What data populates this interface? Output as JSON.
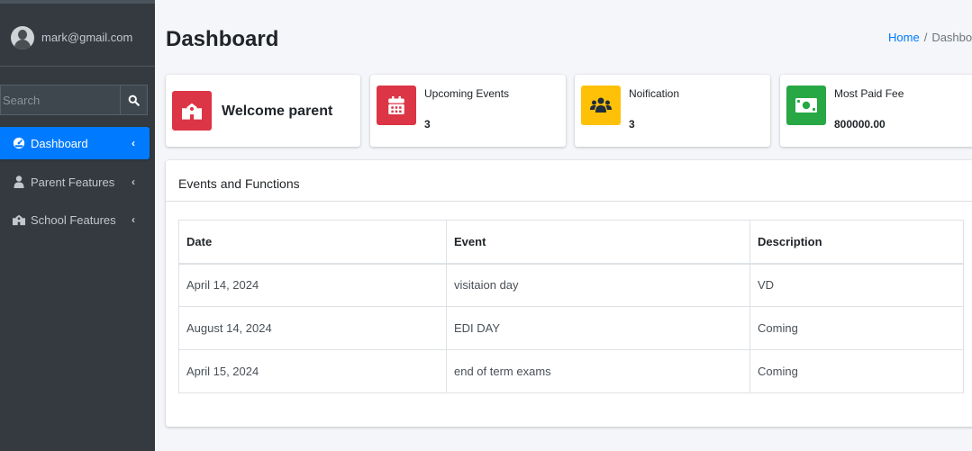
{
  "user": {
    "email": "mark@gmail.com"
  },
  "search": {
    "placeholder": "Search"
  },
  "sidebar": {
    "items": [
      {
        "label": "Dashboard",
        "icon": "tachometer-icon",
        "active": true
      },
      {
        "label": "Parent Features",
        "icon": "user-icon",
        "active": false
      },
      {
        "label": "School Features",
        "icon": "school-icon",
        "active": false
      }
    ]
  },
  "header": {
    "title": "Dashboard",
    "breadcrumb": {
      "home": "Home",
      "separator": "/",
      "current": "Dashboard"
    }
  },
  "info_boxes": [
    {
      "label": "Welcome parent",
      "icon": "school-icon",
      "color": "#dc3545"
    },
    {
      "label": "Upcoming Events",
      "value": "3",
      "icon": "calendar-icon",
      "color": "#dc3545"
    },
    {
      "label": "Noification",
      "value": "3",
      "icon": "users-icon",
      "color": "#ffc107"
    },
    {
      "label": "Most Paid Fee",
      "value": "800000.00",
      "icon": "money-bill-icon",
      "color": "#28a745"
    }
  ],
  "events": {
    "title": "Events and Functions",
    "columns": [
      "Date",
      "Event",
      "Description"
    ],
    "rows": [
      [
        "April 14, 2024",
        "visitaion day",
        "VD"
      ],
      [
        "August 14, 2024",
        "EDI DAY",
        "Coming"
      ],
      [
        "April 15, 2024",
        "end of term exams",
        "Coming"
      ]
    ]
  },
  "colors": {
    "sidebar_bg": "#343a40",
    "accent": "#007bff",
    "danger": "#dc3545",
    "warning": "#ffc107",
    "success": "#28a745"
  }
}
